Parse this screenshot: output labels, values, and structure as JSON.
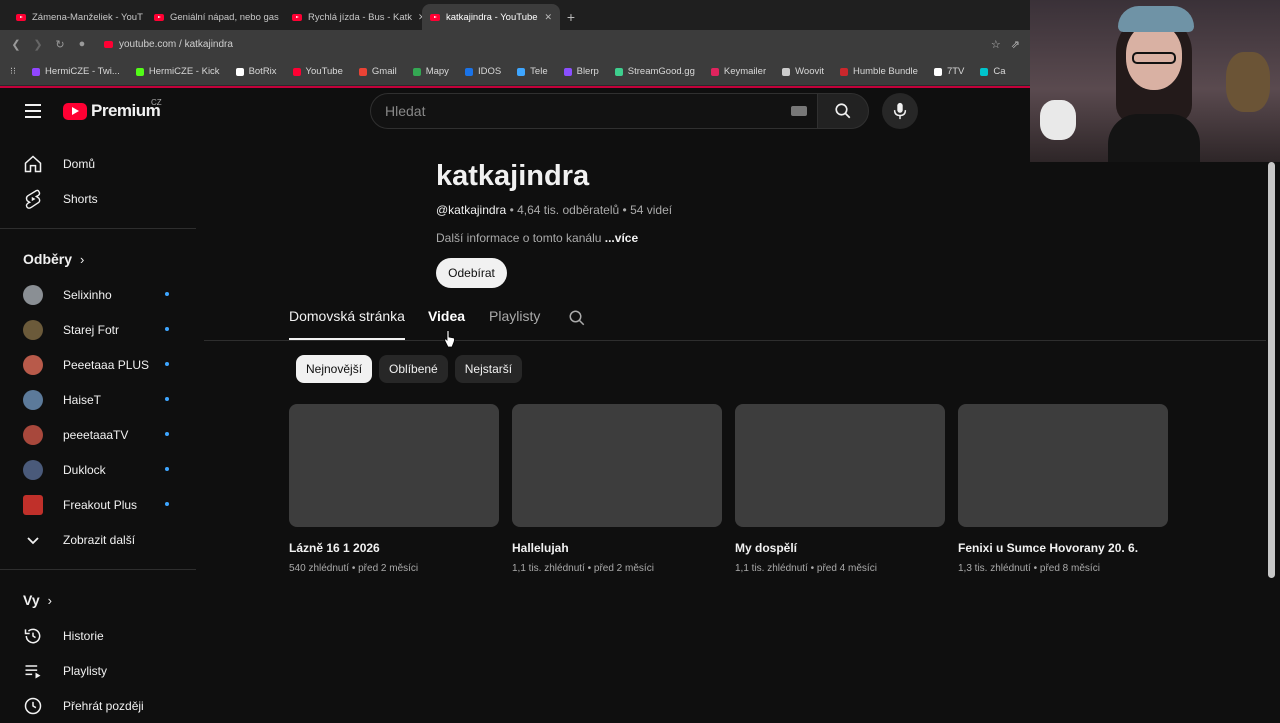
{
  "browser": {
    "tabs": [
      {
        "title": "Zámena-Manželiek - YouT",
        "active": false
      },
      {
        "title": "Geniální nápad, nebo gas",
        "active": false
      },
      {
        "title": "Rychlá jízda - Bus - Katk",
        "active": false
      },
      {
        "title": "katkajindra - YouTube",
        "active": true
      }
    ],
    "new_tab": "+",
    "url": "youtube.com / katkajindra",
    "bookmarks": [
      {
        "label": "HermiCZE - Twi...",
        "color": "#9146ff"
      },
      {
        "label": "HermiCZE - Kick",
        "color": "#53fc18"
      },
      {
        "label": "BotRix",
        "color": "#ffffff"
      },
      {
        "label": "YouTube",
        "color": "#ff0033"
      },
      {
        "label": "Gmail",
        "color": "#ea4335"
      },
      {
        "label": "Mapy",
        "color": "#34a853"
      },
      {
        "label": "IDOS",
        "color": "#1a73e8"
      },
      {
        "label": "Tele",
        "color": "#3ea6ff"
      },
      {
        "label": "Blerp",
        "color": "#8a4fff"
      },
      {
        "label": "StreamGood.gg",
        "color": "#3ecf8e"
      },
      {
        "label": "Keymailer",
        "color": "#e0245e"
      },
      {
        "label": "Woovit",
        "color": "#cccccc"
      },
      {
        "label": "Humble Bundle",
        "color": "#cb272c"
      },
      {
        "label": "7TV",
        "color": "#ffffff"
      },
      {
        "label": "Ca",
        "color": "#00c4cc"
      }
    ]
  },
  "header": {
    "logo_text": "Premium",
    "country": "CZ",
    "search_placeholder": "Hledat"
  },
  "sidebar": {
    "main": [
      {
        "label": "Domů",
        "icon": "home-icon"
      },
      {
        "label": "Shorts",
        "icon": "shorts-icon"
      }
    ],
    "subs_title": "Odběry",
    "subs": [
      {
        "label": "Selixinho",
        "color": "#8a8f94"
      },
      {
        "label": "Starej Fotr",
        "color": "#6b5a3a"
      },
      {
        "label": "Peeetaaa PLUS",
        "color": "#b85a4a"
      },
      {
        "label": "HaiseT",
        "color": "#5c7a9a"
      },
      {
        "label": "peeetaaaTV",
        "color": "#a8483c"
      },
      {
        "label": "Duklock",
        "color": "#4a5a7a"
      },
      {
        "label": "Freakout Plus",
        "color": "#c0302a"
      }
    ],
    "show_more": "Zobrazit další",
    "you_title": "Vy",
    "you": [
      {
        "label": "Historie",
        "icon": "history-icon"
      },
      {
        "label": "Playlisty",
        "icon": "playlist-icon"
      },
      {
        "label": "Přehrát později",
        "icon": "watch-later-icon"
      }
    ]
  },
  "channel": {
    "name": "katkajindra",
    "handle": "@katkajindra",
    "subscribers": "4,64 tis. odběratelů",
    "video_count": "54 videí",
    "more_info": "Další informace o tomto kanálu",
    "more_link": "...více",
    "subscribe": "Odebírat",
    "tabs": [
      "Domovská stránka",
      "Videa",
      "Playlisty"
    ],
    "chips": [
      "Nejnovější",
      "Oblíbené",
      "Nejstarší"
    ],
    "videos": [
      {
        "title": "Lázně 16 1 2026",
        "views": "540 zhlédnutí",
        "age": "před 2 měsíci"
      },
      {
        "title": "Hallelujah",
        "views": "1,1 tis. zhlédnutí",
        "age": "před 2 měsíci"
      },
      {
        "title": "My dospělí",
        "views": "1,1 tis. zhlédnutí",
        "age": "před 4 měsíci"
      },
      {
        "title": "Fenixi u Sumce Hovorany 20. 6.",
        "views": "1,3 tis. zhlédnutí",
        "age": "před 8 měsíci"
      }
    ]
  }
}
